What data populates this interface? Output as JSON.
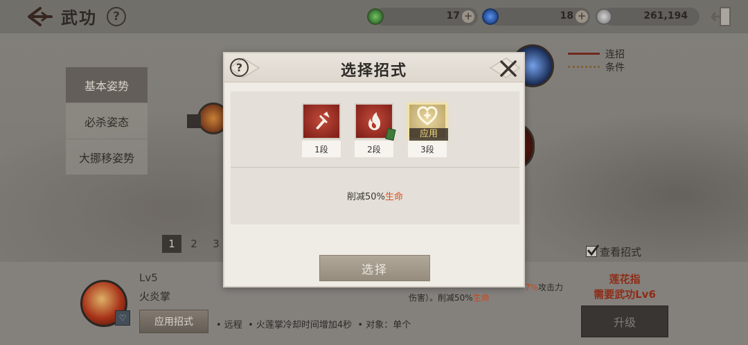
{
  "header": {
    "title": "武功",
    "help_glyph": "?",
    "currencies": [
      {
        "icon": "green-jade-icon",
        "value": "17"
      },
      {
        "icon": "blue-orb-icon",
        "value": "18"
      },
      {
        "icon": "silver-coin-icon",
        "value": "261,194"
      }
    ]
  },
  "sidebar": {
    "items": [
      {
        "label": "基本姿势",
        "active": true
      },
      {
        "label": "必杀姿态",
        "active": false
      },
      {
        "label": "大挪移姿势",
        "active": false
      }
    ]
  },
  "legend": {
    "combo": "连招",
    "condition": "条件"
  },
  "pagination": [
    "1",
    "2",
    "3"
  ],
  "view_moves_label": "查看招式",
  "bottom": {
    "level": "Lv5",
    "skill_name": "火炎掌",
    "apply_button": "应用招式",
    "bullets": "• 远程  • 火莲掌冷却时间增加4秒  • 对象：单个",
    "left_snippet": "伤害）。削减50%",
    "left_snippet_hl": "生命",
    "right_snippet_pct": "7%",
    "right_snippet_tail": "攻击力",
    "right_snippet2": "伤害）。削减50%",
    "right_snippet2_hl": "生命",
    "next_skill": "莲花指",
    "requirement": "需要武功Lv6",
    "upgrade_button": "升级"
  },
  "modal": {
    "title": "选择招式",
    "help_glyph": "?",
    "stages": [
      {
        "label": "1段",
        "icon": "sword-up-icon",
        "applied": false
      },
      {
        "label": "2段",
        "icon": "flame-icon",
        "applied": false
      },
      {
        "label": "3段",
        "icon": "heart-plus-icon",
        "applied": true
      }
    ],
    "applied_tag": "应用",
    "description_prefix": "削减50%",
    "description_highlight": "生命",
    "select_button": "选择"
  },
  "colors": {
    "accent_red": "#d8501f",
    "applied_gold": "#f3d680"
  }
}
